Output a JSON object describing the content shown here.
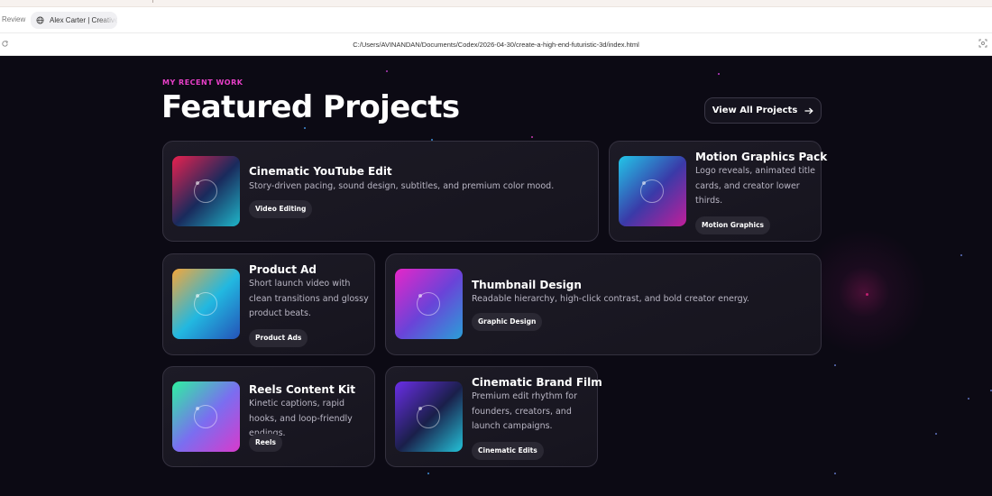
{
  "browser": {
    "review_label": "Review",
    "tab_title": "Alex Carter | Creative",
    "url": "C:/Users/AVINANDAN/Documents/Codex/2026-04-30/create-a-high-end-futuristic-3d/index.html",
    "icons": [
      "globe-icon",
      "reload-icon",
      "screenshot-icon"
    ]
  },
  "section": {
    "eyebrow": "MY RECENT WORK",
    "heading": "Featured Projects",
    "view_all_label": "View All Projects",
    "view_all_icon": "arrow-right-icon"
  },
  "projects": [
    {
      "title": "Cinematic YouTube Edit",
      "description": "Story-driven pacing, sound design, subtitles, and premium color mood.",
      "tag": "Video Editing",
      "thumb_colors": [
        "#e8214f",
        "#1a2a5c",
        "#1fb6c9"
      ]
    },
    {
      "title": "Motion Graphics Pack",
      "description": "Logo reveals, animated title cards, and creator lower thirds.",
      "tag": "Motion Graphics",
      "thumb_colors": [
        "#22c6e8",
        "#3a3aa8",
        "#c21e9a"
      ]
    },
    {
      "title": "Product Ad",
      "description": "Short launch video with clean transitions and glossy product beats.",
      "tag": "Product Ads",
      "thumb_colors": [
        "#f5a63a",
        "#22b8e0",
        "#2452b8"
      ]
    },
    {
      "title": "Thumbnail Design",
      "description": "Readable hierarchy, high-click contrast, and bold creator energy.",
      "tag": "Graphic Design",
      "thumb_colors": [
        "#e626c8",
        "#6a43d8",
        "#2a9fd8"
      ]
    },
    {
      "title": "Reels Content Kit",
      "description": "Kinetic captions, rapid hooks, and loop-friendly endings.",
      "tag": "Reels",
      "thumb_colors": [
        "#2ef0a0",
        "#7a6ef0",
        "#d83acc"
      ]
    },
    {
      "title": "Cinematic Brand Film",
      "description": "Premium edit rhythm for founders, creators, and launch campaigns.",
      "tag": "Cinematic Edits",
      "thumb_colors": [
        "#6a2ee8",
        "#1a1f4a",
        "#24c2d8"
      ]
    }
  ],
  "colors": {
    "accent": "#e83fc8",
    "background": "#0c0a14",
    "card": "#1c1a25",
    "tag_bg": "#2a2833"
  }
}
